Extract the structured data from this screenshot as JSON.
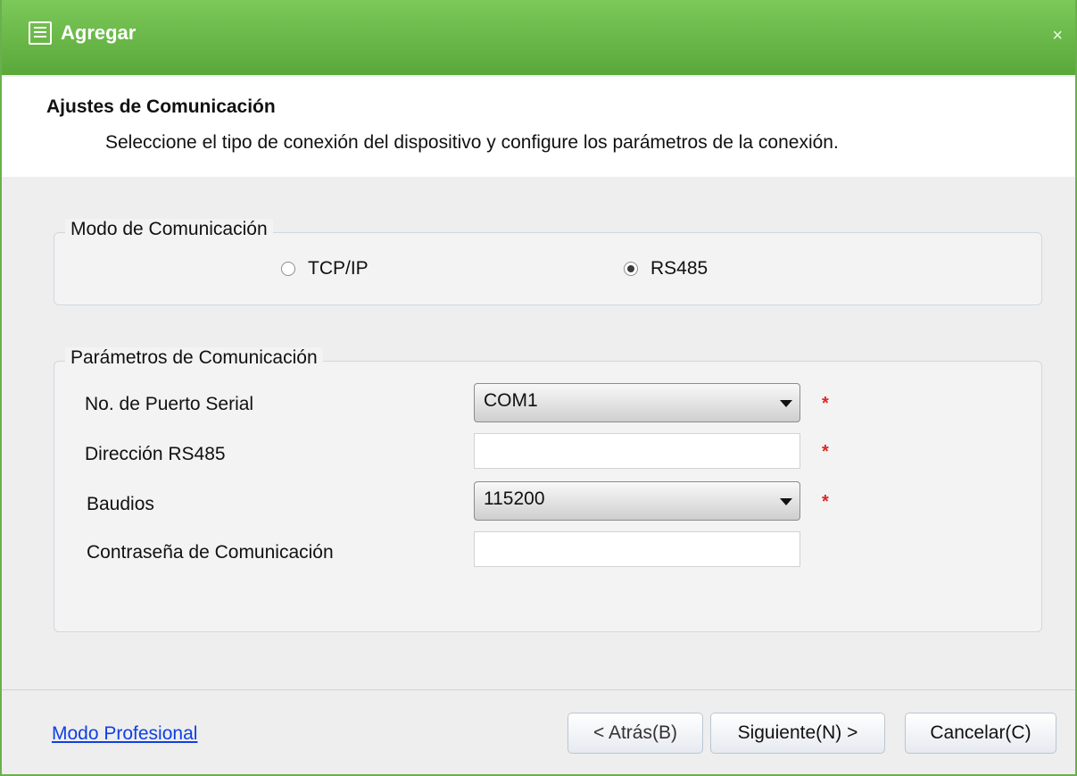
{
  "window": {
    "title": "Agregar",
    "close_label": "×"
  },
  "header": {
    "title": "Ajustes de Comunicación",
    "description": "Seleccione el tipo de conexión del dispositivo y configure los parámetros de la conexión."
  },
  "mode_group": {
    "title": "Modo de Comunicación",
    "options": [
      {
        "label": "TCP/IP",
        "selected": false
      },
      {
        "label": "RS485",
        "selected": true
      }
    ]
  },
  "params_group": {
    "title": "Parámetros de Comunicación",
    "serial_port": {
      "label": "No. de Puerto Serial",
      "value": "COM1",
      "required": "*"
    },
    "rs485_address": {
      "label": "Dirección RS485",
      "value": "",
      "required": "*"
    },
    "baud": {
      "label": "Baudios",
      "value": "115200",
      "required": "*"
    },
    "password": {
      "label": "Contraseña de Comunicación",
      "value": ""
    }
  },
  "footer": {
    "pro_mode_link": "Modo Profesional",
    "back_label": "< Atrás(B)",
    "next_label": "Siguiente(N) >",
    "cancel_label": "Cancelar(C)"
  }
}
